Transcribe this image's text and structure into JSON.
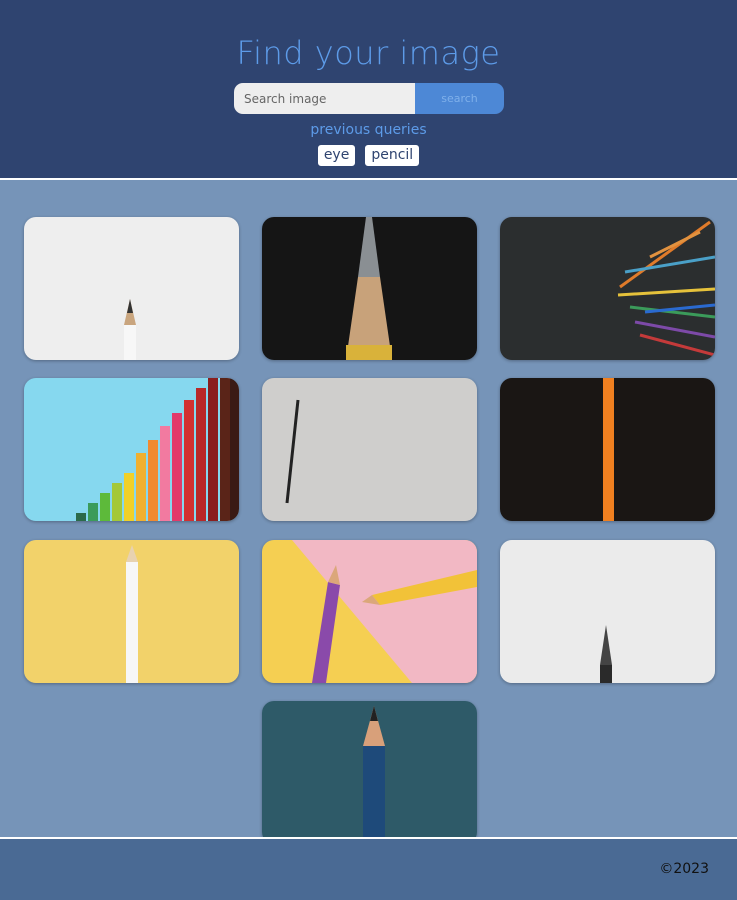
{
  "header": {
    "title": "Find your image",
    "search_placeholder": "Search image",
    "search_button": "search",
    "previous_label": "previous queries",
    "previous_queries": [
      "eye",
      "pencil"
    ]
  },
  "results": [
    {
      "subject": "white pencil tip on white"
    },
    {
      "subject": "sharpened pencil on black"
    },
    {
      "subject": "scattered colored pencils on dark"
    },
    {
      "subject": "rainbow colored pencils on blue"
    },
    {
      "subject": "black pencil on grey"
    },
    {
      "subject": "orange pencil on black"
    },
    {
      "subject": "white pencil on yellow"
    },
    {
      "subject": "purple and yellow pencils on yellow and pink"
    },
    {
      "subject": "black pencil tip on white"
    },
    {
      "subject": "blue pencil on teal"
    }
  ],
  "footer": {
    "copyright": "©2023"
  },
  "colors": {
    "header_bg": "#2f4470",
    "accent": "#5d9be8",
    "button": "#4d88d6",
    "page_bg": "#7694b8",
    "footer_bg": "#4a6a94"
  }
}
